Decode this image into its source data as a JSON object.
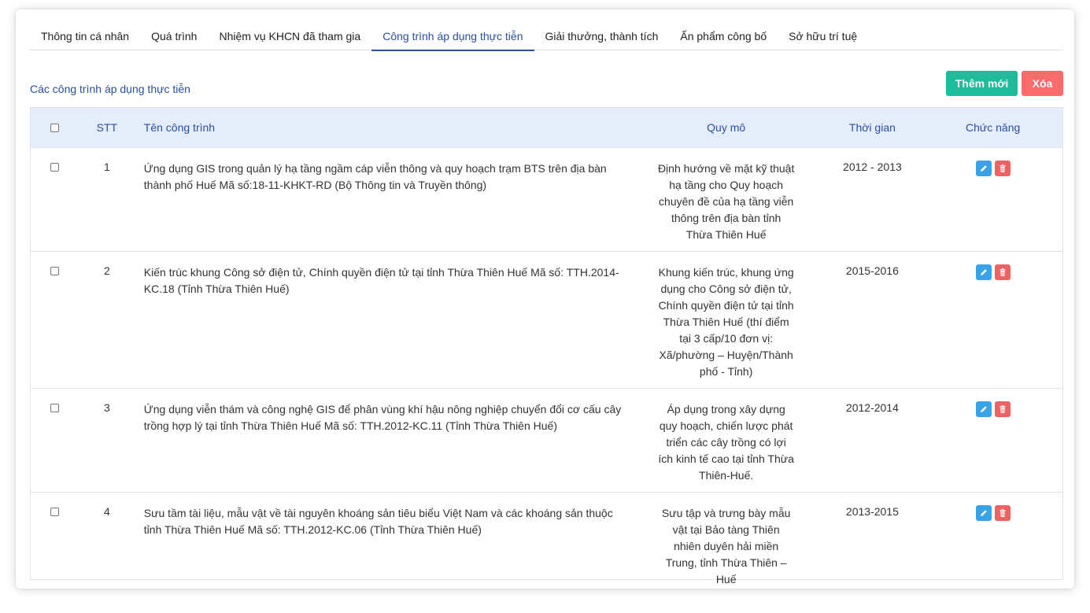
{
  "tabs": [
    {
      "label": "Thông tin cá nhân"
    },
    {
      "label": "Quá trình"
    },
    {
      "label": "Nhiệm vụ KHCN đã tham gia"
    },
    {
      "label": "Công trình áp dụng thực tiễn",
      "active": true
    },
    {
      "label": "Giải thưởng, thành tích"
    },
    {
      "label": "Ấn phẩm công bố"
    },
    {
      "label": "Sở hữu trí tuệ"
    }
  ],
  "section_title": "Các công trình áp dụng thực tiễn",
  "buttons": {
    "add": "Thêm mới",
    "delete": "Xóa"
  },
  "colors": {
    "primary": "#2a4ea0",
    "add_button": "#1fbc9c",
    "delete_button": "#fa6b6b",
    "header_bg": "#e5edfb",
    "edit_icon": "#3aa3e8",
    "trash_icon": "#f06262"
  },
  "table": {
    "headers": {
      "stt": "STT",
      "name": "Tên công trình",
      "scale": "Quy mô",
      "time": "Thời gian",
      "func": "Chức năng"
    },
    "rows": [
      {
        "stt": "1",
        "name": "Ứng dụng GIS trong quản lý hạ tầng ngầm cáp viễn thông và quy hoạch trạm BTS trên địa bàn thành phố Huế Mã số:18-11-KHKT-RD (Bộ Thông tin và Truyền thông)",
        "scale": "Định hướng về mặt kỹ thuật hạ tầng cho Quy hoạch chuyên đề của hạ tầng viễn thông trên địa bàn tỉnh Thừa Thiên Huế",
        "time": "2012 - 2013"
      },
      {
        "stt": "2",
        "name": "Kiến trúc khung Công sở điện tử, Chính quyền điện tử tại tỉnh Thừa Thiên Huế  Mã số: TTH.2014-KC.18 (Tỉnh Thừa Thiên Huế)",
        "scale": "Khung kiến trúc, khung ứng dụng cho Công sở điện tử, Chính quyền điện tử tại tỉnh Thừa Thiên Huế (thí điểm tại 3 cấp/10 đơn vị: Xã/phường – Huyện/Thành phố - Tỉnh)",
        "time": "2015-2016"
      },
      {
        "stt": "3",
        "name": "Ứng dụng viễn thám và công nghệ GIS để phân vùng khí hậu nông nghiệp chuyển đổi cơ cấu cây trồng hợp lý tại tỉnh Thừa Thiên Huế Mã số: TTH.2012-KC.11 (Tỉnh Thừa Thiên Huế)",
        "scale": "Áp dụng trong xây dựng quy hoạch, chiến lược phát triển các cây trồng có lợi ích kinh tế cao tại tỉnh Thừa Thiên-Huế.",
        "time": "2012-2014"
      },
      {
        "stt": "4",
        "name": "Sưu tầm tài liệu, mẫu vật về tài nguyên khoáng sản tiêu biểu Việt Nam và các khoáng sản thuộc tỉnh Thừa Thiên Huế Mã số: TTH.2012-KC.06 (Tỉnh Thừa Thiên Huế)",
        "scale": "Sưu tập và trưng bày mẫu vật tại Bảo tàng Thiên nhiên duyên hải miền Trung, tỉnh Thừa Thiên – Huế",
        "time": "2013-2015"
      }
    ]
  }
}
